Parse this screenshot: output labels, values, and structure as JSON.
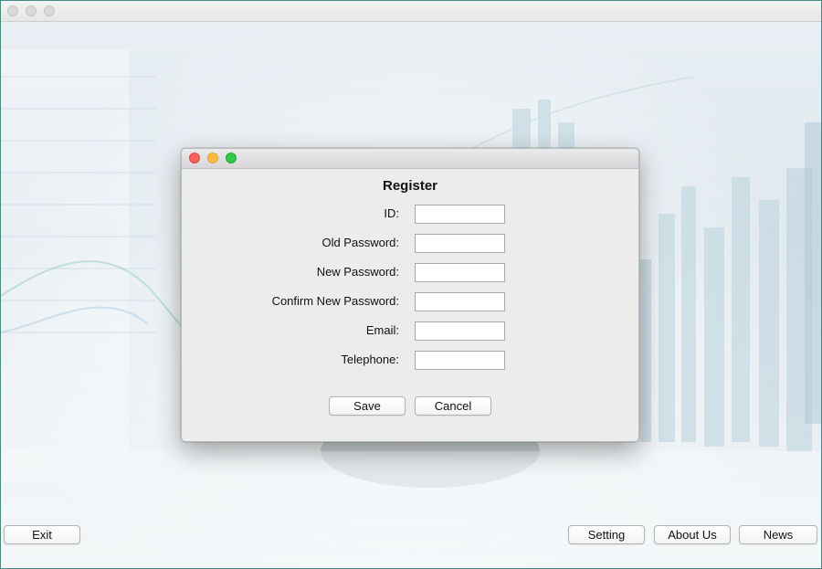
{
  "register_dialog": {
    "title": "Register",
    "fields": [
      {
        "label": "ID:",
        "value": ""
      },
      {
        "label": "Old Password:",
        "value": ""
      },
      {
        "label": "New Password:",
        "value": ""
      },
      {
        "label": "Confirm New Password:",
        "value": ""
      },
      {
        "label": "Email:",
        "value": ""
      },
      {
        "label": "Telephone:",
        "value": ""
      }
    ],
    "save_label": "Save",
    "cancel_label": "Cancel"
  },
  "bottom_bar": {
    "exit_label": "Exit",
    "setting_label": "Setting",
    "about_label": "About Us",
    "news_label": "News"
  },
  "colors": {
    "close": "#fc605c",
    "minimize": "#fdbc40",
    "maximize": "#34c84a",
    "window_border": "#4a8a86"
  }
}
